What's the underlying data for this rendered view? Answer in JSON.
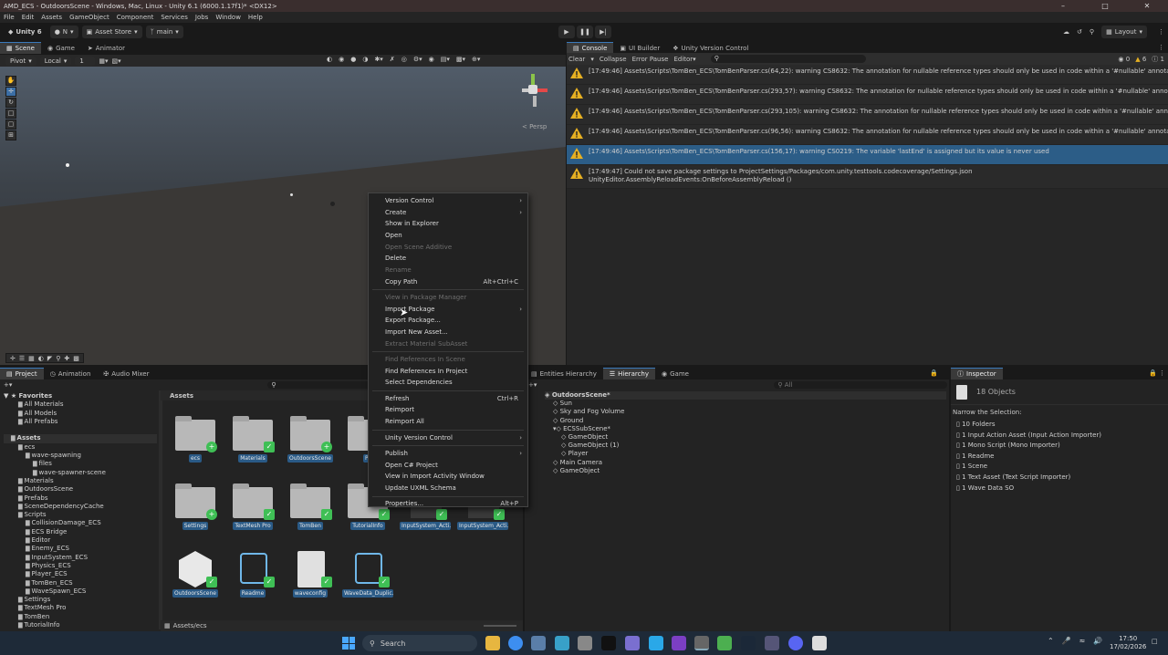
{
  "window": {
    "title": "AMD_ECS - OutdoorsScene - Windows, Mac, Linux - Unity 6.1 (6000.1.17f1)* <DX12>"
  },
  "menu": [
    "File",
    "Edit",
    "Assets",
    "GameObject",
    "Component",
    "Services",
    "Jobs",
    "Window",
    "Help"
  ],
  "toolbar": {
    "unity": "Unity 6",
    "account": "N",
    "asset_store": "Asset Store",
    "branch": "main",
    "layout": "Layout"
  },
  "scene_tabs": [
    "Scene",
    "Game",
    "Animator"
  ],
  "scene_toolbar": {
    "pivot": "Pivot",
    "local": "Local",
    "grid": "1"
  },
  "scene": {
    "persp": "< Persp"
  },
  "console": {
    "tabs": [
      "Console",
      "UI Builder",
      "Unity Version Control"
    ],
    "buttons": [
      "Clear",
      "Collapse",
      "Error Pause",
      "Editor"
    ],
    "counts": {
      "errors": "0",
      "warnings": "6",
      "logs": "1"
    },
    "messages": [
      {
        "text": "[17:49:46] Assets\\Scripts\\TomBen_ECS\\TomBenParser.cs(64,22): warning CS8632: The annotation for nullable reference types should only be used in code within a '#nullable' annotations cont",
        "line2": ""
      },
      {
        "text": "[17:49:46] Assets\\Scripts\\TomBen_ECS\\TomBenParser.cs(293,57): warning CS8632: The annotation for nullable reference types should only be used in code within a '#nullable' annotations cont",
        "line2": ""
      },
      {
        "text": "[17:49:46] Assets\\Scripts\\TomBen_ECS\\TomBenParser.cs(293,105): warning CS8632: The annotation for nullable reference types should only be used in code within a '#nullable' annotations cont",
        "line2": ""
      },
      {
        "text": "[17:49:46] Assets\\Scripts\\TomBen_ECS\\TomBenParser.cs(96,56): warning CS8632: The annotation for nullable reference types should only be used in code within a '#nullable' annotations cont",
        "line2": ""
      },
      {
        "text": "[17:49:46] Assets\\Scripts\\TomBen_ECS\\TomBenParser.cs(156,17): warning CS0219: The variable 'lastEnd' is assigned but its value is never used",
        "line2": ""
      },
      {
        "text": "[17:49:47] Could not save package settings to ProjectSettings/Packages/com.unity.testtools.codecoverage/Settings.json",
        "line2": "UnityEditor.AssemblyReloadEvents:OnBeforeAssemblyReload ()"
      }
    ]
  },
  "project": {
    "tabs": [
      "Project",
      "Animation",
      "Audio Mixer"
    ],
    "favorites": "Favorites",
    "tree": [
      {
        "label": "All Materials",
        "indent": 2
      },
      {
        "label": "All Models",
        "indent": 2
      },
      {
        "label": "All Prefabs",
        "indent": 2
      },
      {
        "label": "",
        "indent": 0
      },
      {
        "label": "Assets",
        "indent": 1
      },
      {
        "label": "ecs",
        "indent": 2
      },
      {
        "label": "wave-spawning",
        "indent": 3
      },
      {
        "label": "files",
        "indent": 4
      },
      {
        "label": "wave-spawner-scene",
        "indent": 4
      },
      {
        "label": "Materials",
        "indent": 2
      },
      {
        "label": "OutdoorsScene",
        "indent": 2
      },
      {
        "label": "Prefabs",
        "indent": 2
      },
      {
        "label": "SceneDependencyCache",
        "indent": 2
      },
      {
        "label": "Scripts",
        "indent": 2
      },
      {
        "label": "CollisionDamage_ECS",
        "indent": 3
      },
      {
        "label": "ECS Bridge",
        "indent": 3
      },
      {
        "label": "Editor",
        "indent": 3
      },
      {
        "label": "Enemy_ECS",
        "indent": 3
      },
      {
        "label": "InputSystem_ECS",
        "indent": 3
      },
      {
        "label": "Physics_ECS",
        "indent": 3
      },
      {
        "label": "Player_ECS",
        "indent": 3
      },
      {
        "label": "TomBen_ECS",
        "indent": 3
      },
      {
        "label": "WaveSpawn_ECS",
        "indent": 3
      },
      {
        "label": "Settings",
        "indent": 2
      },
      {
        "label": "TextMesh Pro",
        "indent": 2
      },
      {
        "label": "TomBen",
        "indent": 2
      },
      {
        "label": "TutorialInfo",
        "indent": 2
      }
    ],
    "breadcrumb": "Assets",
    "footer_path": "Assets/ecs",
    "assets": [
      "ecs",
      "Materials",
      "OutdoorsScene",
      "Pr",
      "Settings",
      "TextMesh Pro",
      "TomBen",
      "TutorialInfo",
      "InputSystem_Acti...",
      "InputSystem_Acti...",
      "OutdoorsScene",
      "Readme",
      "waveconfig",
      "WaveData_Duplic..."
    ]
  },
  "hierarchy": {
    "tabs": [
      "Entities Hierarchy",
      "Hierarchy",
      "Game"
    ],
    "search_placeholder": "All",
    "items": [
      {
        "label": "OutdoorsScene*",
        "indent": 0
      },
      {
        "label": "Sun",
        "indent": 1
      },
      {
        "label": "Sky and Fog Volume",
        "indent": 1
      },
      {
        "label": "Ground",
        "indent": 1
      },
      {
        "label": "ECSSubScene*",
        "indent": 1
      },
      {
        "label": "GameObject",
        "indent": 2
      },
      {
        "label": "GameObject (1)",
        "indent": 2
      },
      {
        "label": "Player",
        "indent": 2
      },
      {
        "label": "Main Camera",
        "indent": 1
      },
      {
        "label": "GameObject",
        "indent": 1
      }
    ]
  },
  "inspector": {
    "tab": "Inspector",
    "count": "18 Objects",
    "narrow": "Narrow the Selection:",
    "items": [
      "10 Folders",
      "1 Input Action Asset (Input Action Importer)",
      "1 Mono Script (Mono Importer)",
      "1 Readme",
      "1 Scene",
      "1 Text Asset (Text Script Importer)",
      "1 Wave Data SO"
    ]
  },
  "context_menu": [
    {
      "label": "Version Control",
      "sub": true
    },
    {
      "label": "Create",
      "sub": true
    },
    {
      "label": "Show in Explorer"
    },
    {
      "label": "Open"
    },
    {
      "label": "Open Scene Additive",
      "disabled": true
    },
    {
      "label": "Delete"
    },
    {
      "label": "Rename",
      "disabled": true
    },
    {
      "label": "Copy Path",
      "shortcut": "Alt+Ctrl+C"
    },
    {
      "sep": true
    },
    {
      "label": "View in Package Manager",
      "disabled": true
    },
    {
      "label": "Import Package",
      "sub": true
    },
    {
      "label": "Export Package..."
    },
    {
      "label": "Import New Asset..."
    },
    {
      "label": "Extract Material SubAsset",
      "disabled": true
    },
    {
      "sep": true
    },
    {
      "label": "Find References In Scene",
      "disabled": true
    },
    {
      "label": "Find References In Project"
    },
    {
      "label": "Select Dependencies"
    },
    {
      "sep": true
    },
    {
      "label": "Refresh",
      "shortcut": "Ctrl+R"
    },
    {
      "label": "Reimport"
    },
    {
      "label": "Reimport All"
    },
    {
      "sep": true
    },
    {
      "label": "Unity Version Control",
      "sub": true
    },
    {
      "sep": true
    },
    {
      "label": "Publish",
      "sub": true
    },
    {
      "label": "Open C# Project"
    },
    {
      "label": "View in Import Activity Window"
    },
    {
      "label": "Update UXML Schema"
    },
    {
      "sep": true
    },
    {
      "label": "Properties...",
      "shortcut": "Alt+P"
    }
  ],
  "taskbar": {
    "search": "Search",
    "time": "17:50",
    "date": "17/02/2026"
  }
}
